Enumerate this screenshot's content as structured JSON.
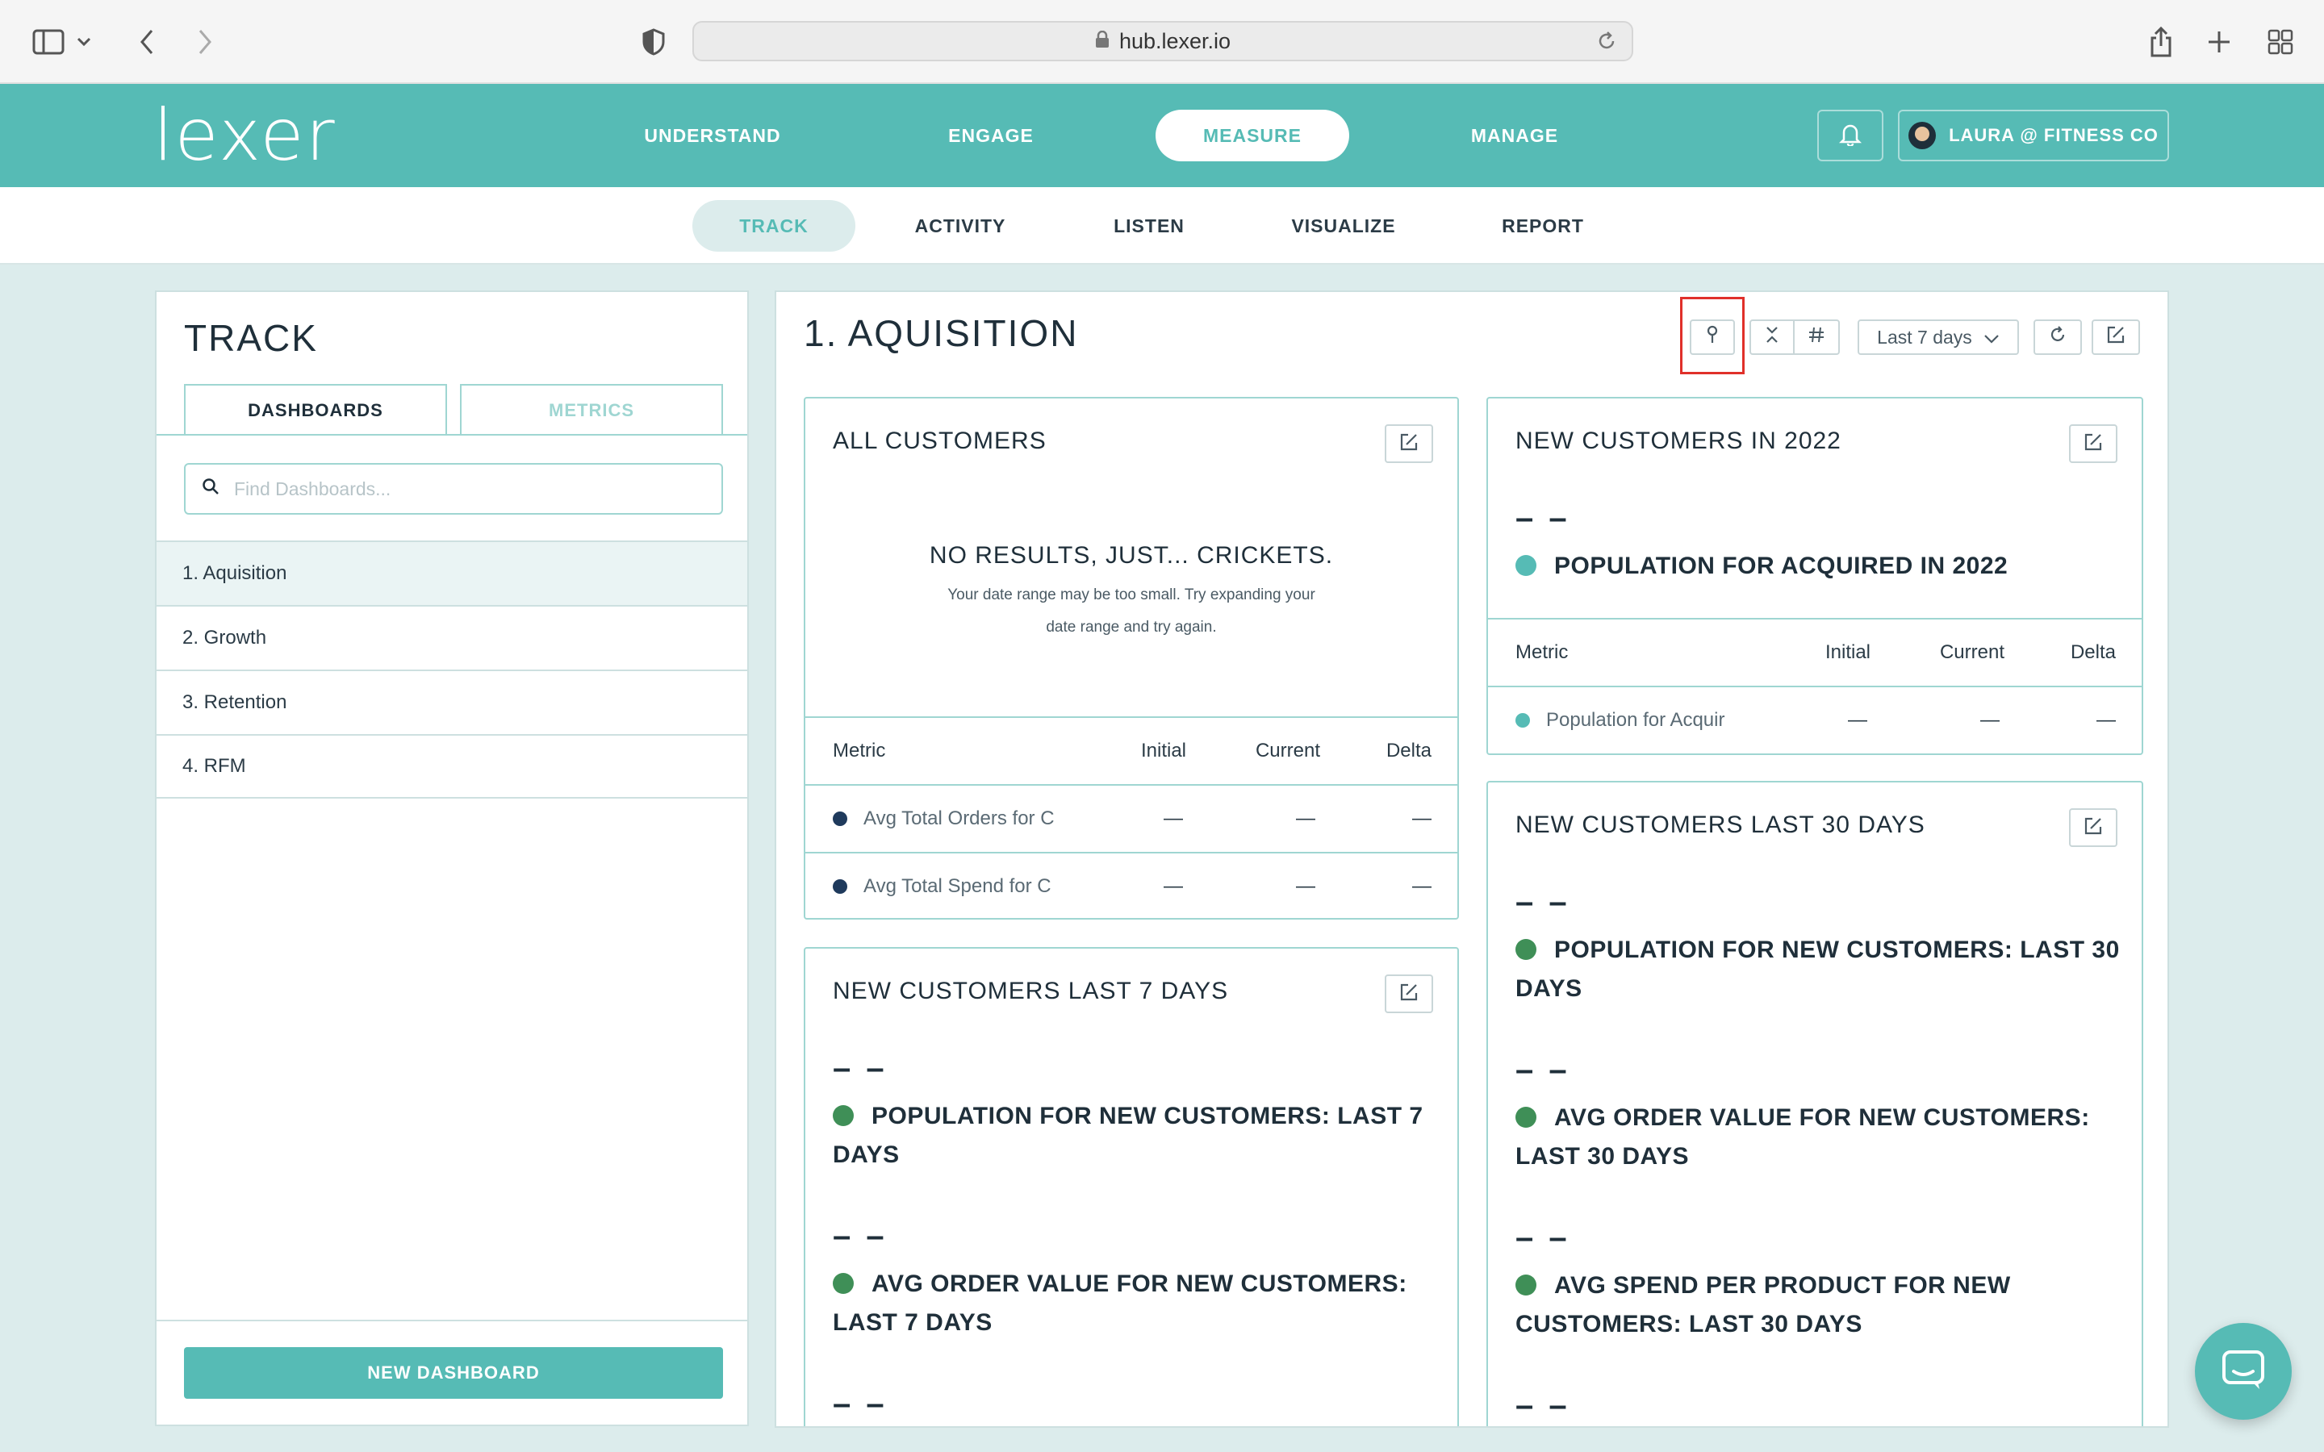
{
  "browser": {
    "url": "hub.lexer.io"
  },
  "app": {
    "logo": "lexer",
    "nav": [
      {
        "label": "UNDERSTAND"
      },
      {
        "label": "ENGAGE"
      },
      {
        "label": "MEASURE"
      },
      {
        "label": "MANAGE"
      }
    ],
    "user": "LAURA @ FITNESS CO"
  },
  "subnav": [
    {
      "label": "TRACK"
    },
    {
      "label": "ACTIVITY"
    },
    {
      "label": "LISTEN"
    },
    {
      "label": "VISUALIZE"
    },
    {
      "label": "REPORT"
    }
  ],
  "left": {
    "title": "TRACK",
    "tabs": {
      "dashboards": "DASHBOARDS",
      "metrics": "METRICS"
    },
    "search_placeholder": "Find Dashboards...",
    "dashboards": [
      "1. Aquisition",
      "2. Growth",
      "3. Retention",
      "4. RFM"
    ],
    "new_button": "NEW DASHBOARD"
  },
  "main": {
    "title": "1. AQUISITION",
    "date_range": "Last 7 days",
    "table_headers": {
      "metric": "Metric",
      "initial": "Initial",
      "current": "Current",
      "delta": "Delta"
    },
    "dash": "—",
    "bigdash": "– –",
    "all_customers": {
      "title": "ALL CUSTOMERS",
      "empty_title": "NO RESULTS, JUST... CRICKETS.",
      "empty_line1": "Your date range may be too small. Try expanding your",
      "empty_line2": "date range and try again.",
      "rows": [
        "Avg Total Orders for C",
        "Avg Total Spend for C"
      ]
    },
    "new_2022": {
      "title": "NEW CUSTOMERS IN 2022",
      "metric": "POPULATION FOR ACQUIRED IN 2022",
      "row": "Population for Acquir"
    },
    "last7": {
      "title": "NEW CUSTOMERS LAST 7 DAYS",
      "metric1_l1": "POPULATION FOR NEW CUSTOMERS: LAST 7",
      "metric1_l2": "DAYS",
      "metric2_l1": "AVG ORDER VALUE FOR NEW CUSTOMERS:",
      "metric2_l2": "LAST 7 DAYS"
    },
    "last30": {
      "title": "NEW CUSTOMERS LAST 30 DAYS",
      "metric1_l1": "POPULATION FOR NEW CUSTOMERS: LAST 30",
      "metric1_l2": "DAYS",
      "metric2_l1": "AVG ORDER VALUE FOR NEW CUSTOMERS:",
      "metric2_l2": "LAST 30 DAYS",
      "metric3_l1": "AVG SPEND PER PRODUCT FOR NEW",
      "metric3_l2": "CUSTOMERS: LAST 30 DAYS"
    }
  },
  "colors": {
    "accent": "#56bbb5",
    "highlight": "#e0302a",
    "green": "#3f8f57",
    "navy": "#1f3a5c"
  }
}
